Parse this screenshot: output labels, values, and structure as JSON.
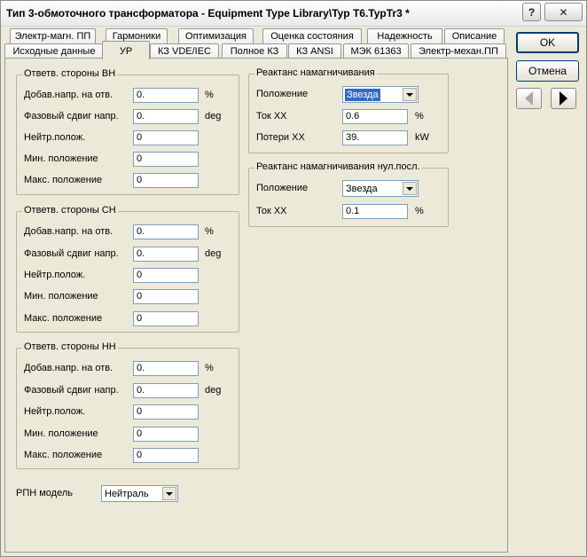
{
  "window": {
    "title": "Тип 3-обмоточного трансформатора - Equipment Type Library\\Typ T6.TypTr3 *",
    "help_glyph": "?",
    "close_glyph": "✕"
  },
  "tabs_row1": [
    "Электр-магн. ПП",
    "Гармоники",
    "Оптимизация",
    "Оценка состояния",
    "Надежность",
    "Описание"
  ],
  "tabs_row2": [
    "Исходные данные",
    "УР",
    "КЗ VDE/IEC",
    "Полное КЗ",
    "КЗ ANSI",
    "МЭК 61363",
    "Электр-механ.ПП"
  ],
  "active_tab": "УР",
  "buttons": {
    "ok": "OK",
    "cancel": "Отмена"
  },
  "taps": [
    {
      "title": "Ответв. стороны ВН",
      "fields": [
        {
          "label": "Добав.напр. на отв.",
          "value": "0.",
          "unit": "%"
        },
        {
          "label": "Фазовый сдвиг напр.",
          "value": "0.",
          "unit": "deg"
        },
        {
          "label": "Нейтр.полож.",
          "value": "0",
          "unit": ""
        },
        {
          "label": "Мин. положение",
          "value": "0",
          "unit": ""
        },
        {
          "label": "Макс. положение",
          "value": "0",
          "unit": ""
        }
      ]
    },
    {
      "title": "Ответв. стороны СН",
      "fields": [
        {
          "label": "Добав.напр. на отв.",
          "value": "0.",
          "unit": "%"
        },
        {
          "label": "Фазовый сдвиг напр.",
          "value": "0.",
          "unit": "deg"
        },
        {
          "label": "Нейтр.полож.",
          "value": "0",
          "unit": ""
        },
        {
          "label": "Мин. положение",
          "value": "0",
          "unit": ""
        },
        {
          "label": "Макс. положение",
          "value": "0",
          "unit": ""
        }
      ]
    },
    {
      "title": "Ответв. стороны НН",
      "fields": [
        {
          "label": "Добав.напр. на отв.",
          "value": "0.",
          "unit": "%"
        },
        {
          "label": "Фазовый сдвиг напр.",
          "value": "0.",
          "unit": "deg"
        },
        {
          "label": "Нейтр.полож.",
          "value": "0",
          "unit": ""
        },
        {
          "label": "Мин. положение",
          "value": "0",
          "unit": ""
        },
        {
          "label": "Макс. положение",
          "value": "0",
          "unit": ""
        }
      ]
    }
  ],
  "magnetizing": {
    "title": "Реактанс намагничивания",
    "position_label": "Положение",
    "position_value": "Звезда",
    "no_load_current_label": "Ток ХХ",
    "no_load_current_value": "0.6",
    "no_load_current_unit": "%",
    "no_load_losses_label": "Потери ХХ",
    "no_load_losses_value": "39.",
    "no_load_losses_unit": "kW"
  },
  "zero_seq_magnetizing": {
    "title": "Реактанс намагничивания нул.посл.",
    "position_label": "Положение",
    "position_value": "Звезда",
    "no_load_current_label": "Ток ХХ",
    "no_load_current_value": "0.1",
    "no_load_current_unit": "%"
  },
  "oltc": {
    "label": "РПН модель",
    "value": "Нейтраль"
  }
}
